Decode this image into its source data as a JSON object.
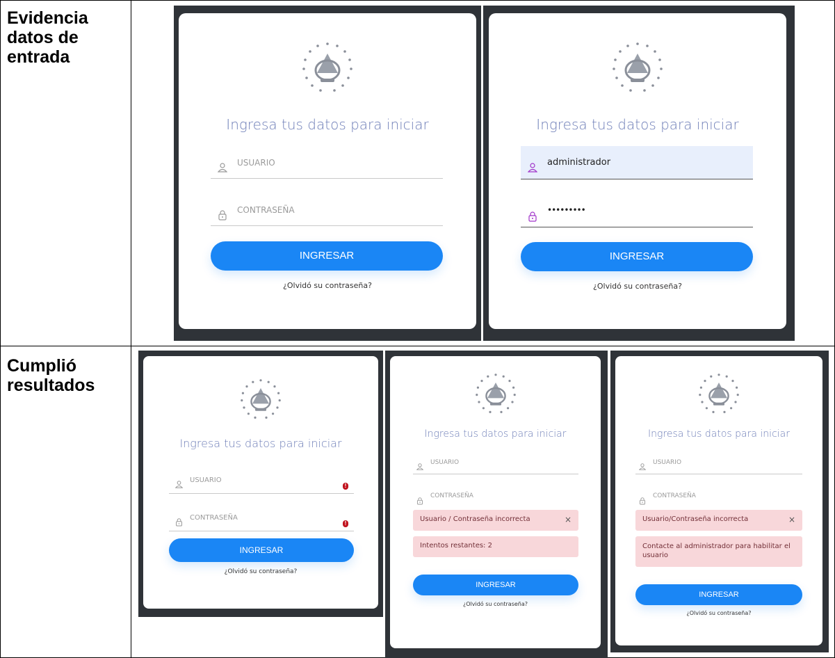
{
  "rows": [
    {
      "label": "Evidencia\ndatos de\nentrada"
    },
    {
      "label": "Cumplió\nresultados"
    }
  ],
  "login": {
    "heading": "Ingresa tus datos para iniciar",
    "user_placeholder": "USUARIO",
    "pass_placeholder": "CONTRASEÑA",
    "submit": "INGRESAR",
    "forgot": "¿Olvidó su contraseña?"
  },
  "filled": {
    "username": "administrador",
    "password": "•••••••••"
  },
  "errors": {
    "required_icon": "!",
    "alert_wrong_1": "Usuario / Contraseña incorrecta",
    "alert_attempts": "Intentos restantes: 2",
    "alert_wrong_2": "Usuario/Contraseña incorrecta",
    "alert_contact": "Contacte al administrador para habilitar el usuario",
    "close_glyph": "×"
  },
  "icons": [
    "emblem-icon",
    "user-icon",
    "lock-icon",
    "alert-circle-icon",
    "close-icon"
  ],
  "colors": {
    "accent": "#1a86f5",
    "heading": "#6f7fb8",
    "alert_bg": "#f8d7da",
    "error": "#c0121d"
  }
}
